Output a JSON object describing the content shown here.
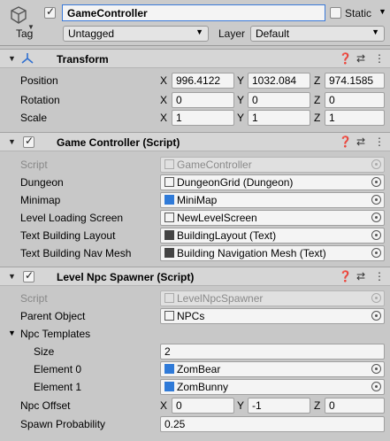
{
  "header": {
    "object_name": "GameController",
    "active": true,
    "static_label": "Static",
    "tag_label": "Tag",
    "tag_value": "Untagged",
    "layer_label": "Layer",
    "layer_value": "Default"
  },
  "transform": {
    "title": "Transform",
    "position": {
      "label": "Position",
      "x": "996.4122",
      "y": "1032.084",
      "z": "974.1585"
    },
    "rotation": {
      "label": "Rotation",
      "x": "0",
      "y": "0",
      "z": "0"
    },
    "scale": {
      "label": "Scale",
      "x": "1",
      "y": "1",
      "z": "1"
    }
  },
  "game_controller": {
    "title": "Game Controller (Script)",
    "script_label": "Script",
    "script_value": "GameController",
    "dungeon_label": "Dungeon",
    "dungeon_value": "DungeonGrid (Dungeon)",
    "minimap_label": "Minimap",
    "minimap_value": "MiniMap",
    "loading_label": "Level Loading Screen",
    "loading_value": "NewLevelScreen",
    "layout_label": "Text Building Layout",
    "layout_value": "BuildingLayout (Text)",
    "navmesh_label": "Text Building Nav Mesh",
    "navmesh_value": "Building Navigation Mesh (Text)"
  },
  "npc_spawner": {
    "title": "Level Npc Spawner (Script)",
    "script_label": "Script",
    "script_value": "LevelNpcSpawner",
    "parent_label": "Parent Object",
    "parent_value": "NPCs",
    "templates_label": "Npc Templates",
    "size_label": "Size",
    "size_value": "2",
    "element0_label": "Element 0",
    "element0_value": "ZomBear",
    "element1_label": "Element 1",
    "element1_value": "ZomBunny",
    "offset_label": "Npc Offset",
    "offset": {
      "x": "0",
      "y": "-1",
      "z": "0"
    },
    "probability_label": "Spawn Probability",
    "probability_value": "0.25"
  },
  "axes": {
    "x": "X",
    "y": "Y",
    "z": "Z"
  },
  "icons": {
    "gameobject": "cube-icon",
    "transform": "transform-axes-icon",
    "script": "script-hash-icon",
    "help": "help-icon",
    "presets": "presets-icon",
    "menu": "kebab-menu-icon"
  },
  "colors": {
    "accent": "#3a79d8",
    "prefab_blue": "#2f7ad8"
  }
}
